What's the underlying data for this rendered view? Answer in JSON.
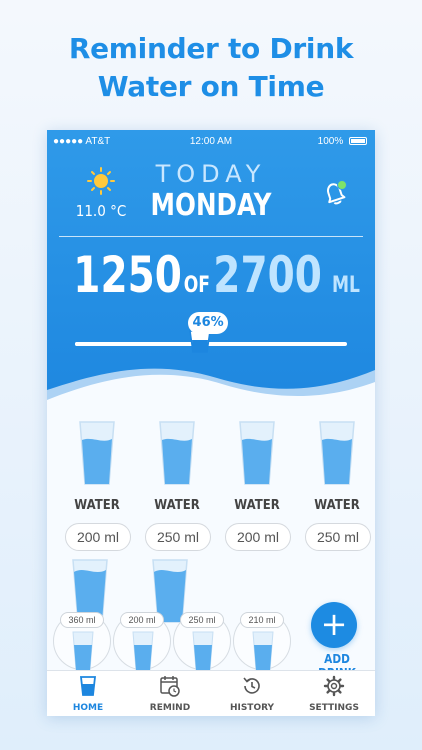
{
  "headline": {
    "line1": "Reminder to Drink",
    "line2": "Water on Time"
  },
  "status_bar": {
    "carrier": "●●●●● AT&T",
    "time": "12:00 AM",
    "battery": "100%"
  },
  "header": {
    "temperature": "11.0 °C",
    "today_label": "TODAY",
    "day_name": "MONDAY"
  },
  "intake": {
    "current": "1250",
    "of_label": "OF",
    "goal": "2700",
    "unit": "ML",
    "progress_label": "46%",
    "progress_fraction": 0.46
  },
  "drinks": [
    {
      "label": "WATER",
      "amount": "200 ml"
    },
    {
      "label": "WATER",
      "amount": "250 ml"
    },
    {
      "label": "WATER",
      "amount": "200 ml"
    },
    {
      "label": "WATER",
      "amount": "250 ml"
    }
  ],
  "quick_amounts": [
    "360 ml",
    "200 ml",
    "250 ml",
    "210 ml"
  ],
  "add_drink_label": "ADD DRINK",
  "add_symbol": "+",
  "tabs": [
    {
      "label": "HOME",
      "icon": "cup-icon",
      "active": true
    },
    {
      "label": "REMIND",
      "icon": "calendar-clock-icon",
      "active": false
    },
    {
      "label": "HISTORY",
      "icon": "history-icon",
      "active": false
    },
    {
      "label": "SETTINGS",
      "icon": "gear-icon",
      "active": false
    }
  ],
  "colors": {
    "accent": "#1d86df",
    "headline": "#1e8ee6",
    "water": "#4ea8ee",
    "notification_dot": "#7ee36a"
  }
}
